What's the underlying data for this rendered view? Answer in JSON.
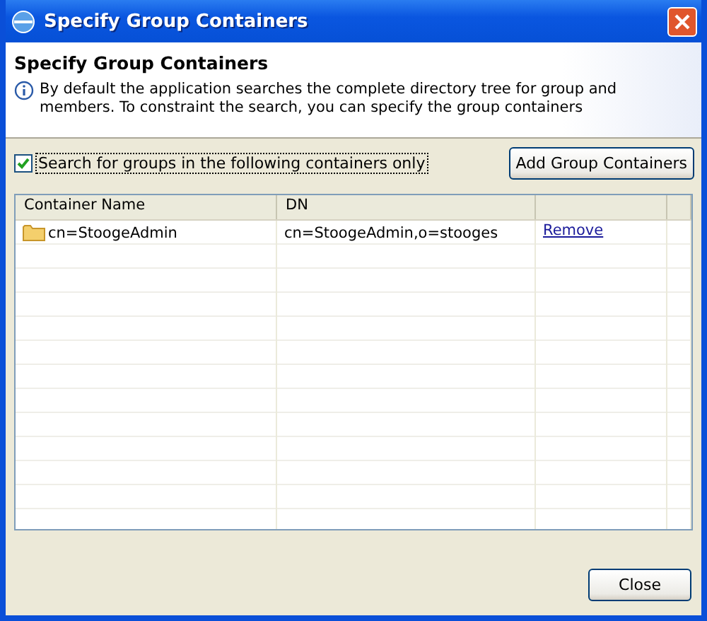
{
  "window": {
    "title": "Specify Group Containers"
  },
  "header": {
    "title": "Specify Group Containers",
    "message": "By default the application searches the complete directory tree for group and members. To constraint the search, you can specify the group containers"
  },
  "filter": {
    "label": "Search for groups in the following containers only",
    "checked": true
  },
  "add_button": "Add Group Containers",
  "table": {
    "columns": [
      "Container Name",
      "DN"
    ],
    "rows": [
      {
        "name": "cn=StoogeAdmin",
        "dn": "cn=StoogeAdmin,o=stooges",
        "action": "Remove"
      }
    ]
  },
  "buttons": [
    "Close"
  ]
}
